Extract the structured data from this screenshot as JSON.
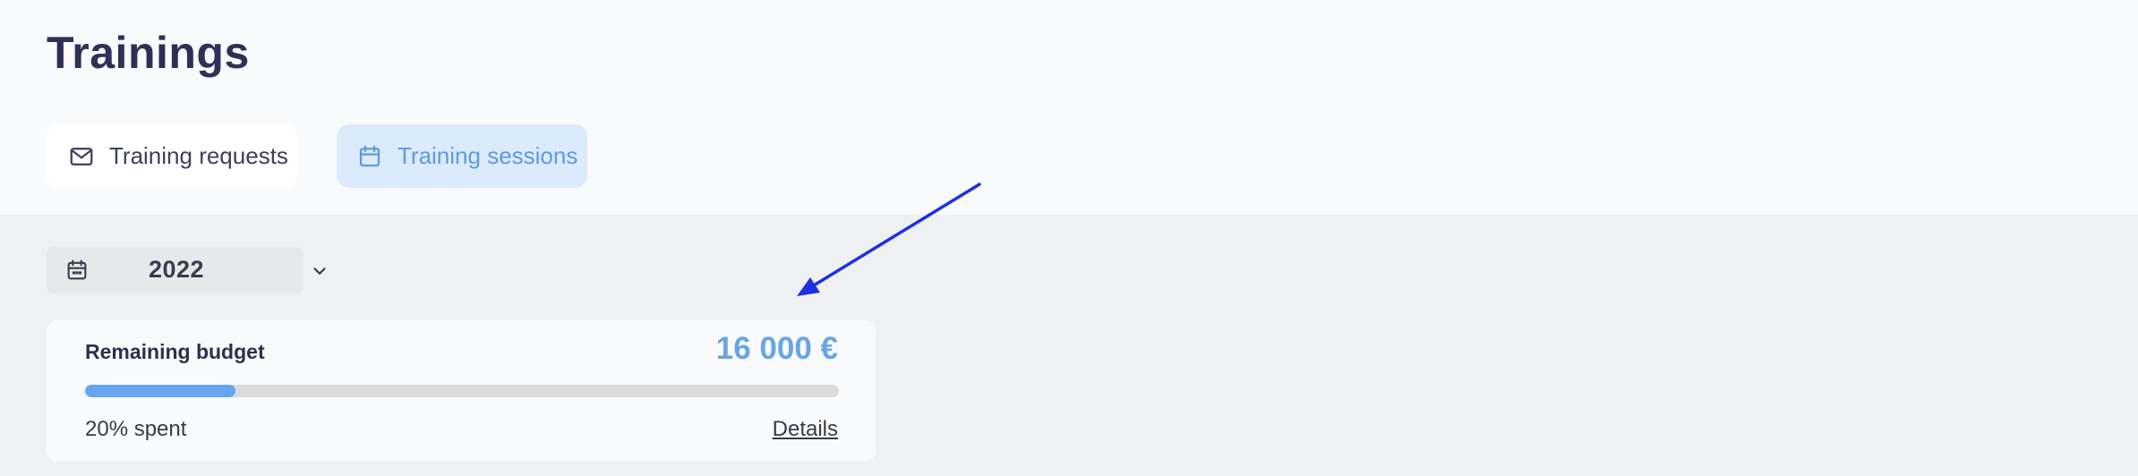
{
  "page": {
    "title": "Trainings"
  },
  "tabs": [
    {
      "label": "Training requests",
      "icon": "envelope-icon",
      "active": false
    },
    {
      "label": "Training sessions",
      "icon": "calendar-icon",
      "active": true
    }
  ],
  "year_filter": {
    "selected": "2022",
    "icon": "calendar-icon"
  },
  "budget": {
    "label": "Remaining budget",
    "amount": "16 000 €",
    "spent_fraction": 0.2,
    "spent_text": "20% spent",
    "details_label": "Details"
  },
  "colors": {
    "accent": "#69a5e5",
    "active_tab_bg": "#dcebfb",
    "progress_fill": "#66a6ef",
    "progress_track": "#dcdcdd",
    "annotation_arrow": "#1c31e0"
  }
}
